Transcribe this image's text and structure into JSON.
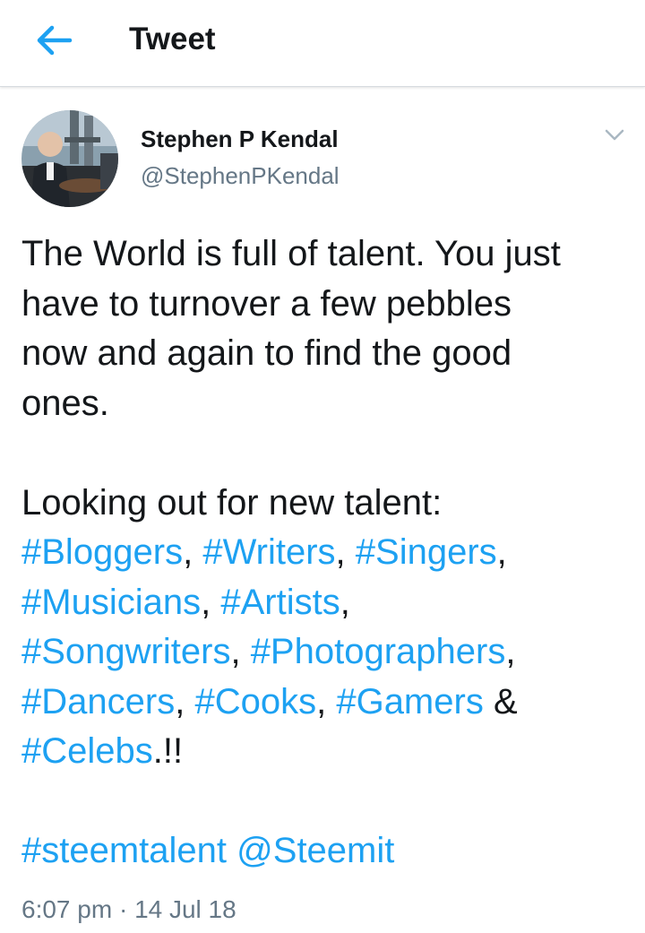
{
  "header": {
    "title": "Tweet",
    "back_icon": "arrow-left-icon"
  },
  "colors": {
    "accent": "#1da1f2",
    "text": "#14171a",
    "secondary": "#657786"
  },
  "author": {
    "name": "Stephen P Kendal",
    "handle": "@StephenPKendal"
  },
  "tweet": {
    "line1": "The World is full of talent. You just",
    "line2": "have to turnover a few pebbles",
    "line3": "now and again to find the good",
    "line4": "ones.",
    "intro": "Looking out for new talent:",
    "tags": {
      "bloggers": "#Bloggers",
      "writers": "#Writers",
      "singers": "#Singers",
      "musicians": "#Musicians",
      "artists": "#Artists",
      "songwriters": "#Songwriters",
      "photographers": "#Photographers",
      "dancers": "#Dancers",
      "cooks": "#Cooks",
      "gamers": "#Gamers",
      "celebs": "#Celebs",
      "steemtalent": "#steemtalent"
    },
    "mention": "@Steemit",
    "ampersand": "&",
    "exclaim": ".!!",
    "comma": ","
  },
  "meta": {
    "time": "6:07 pm",
    "separator": "·",
    "date": "14 Jul 18"
  }
}
